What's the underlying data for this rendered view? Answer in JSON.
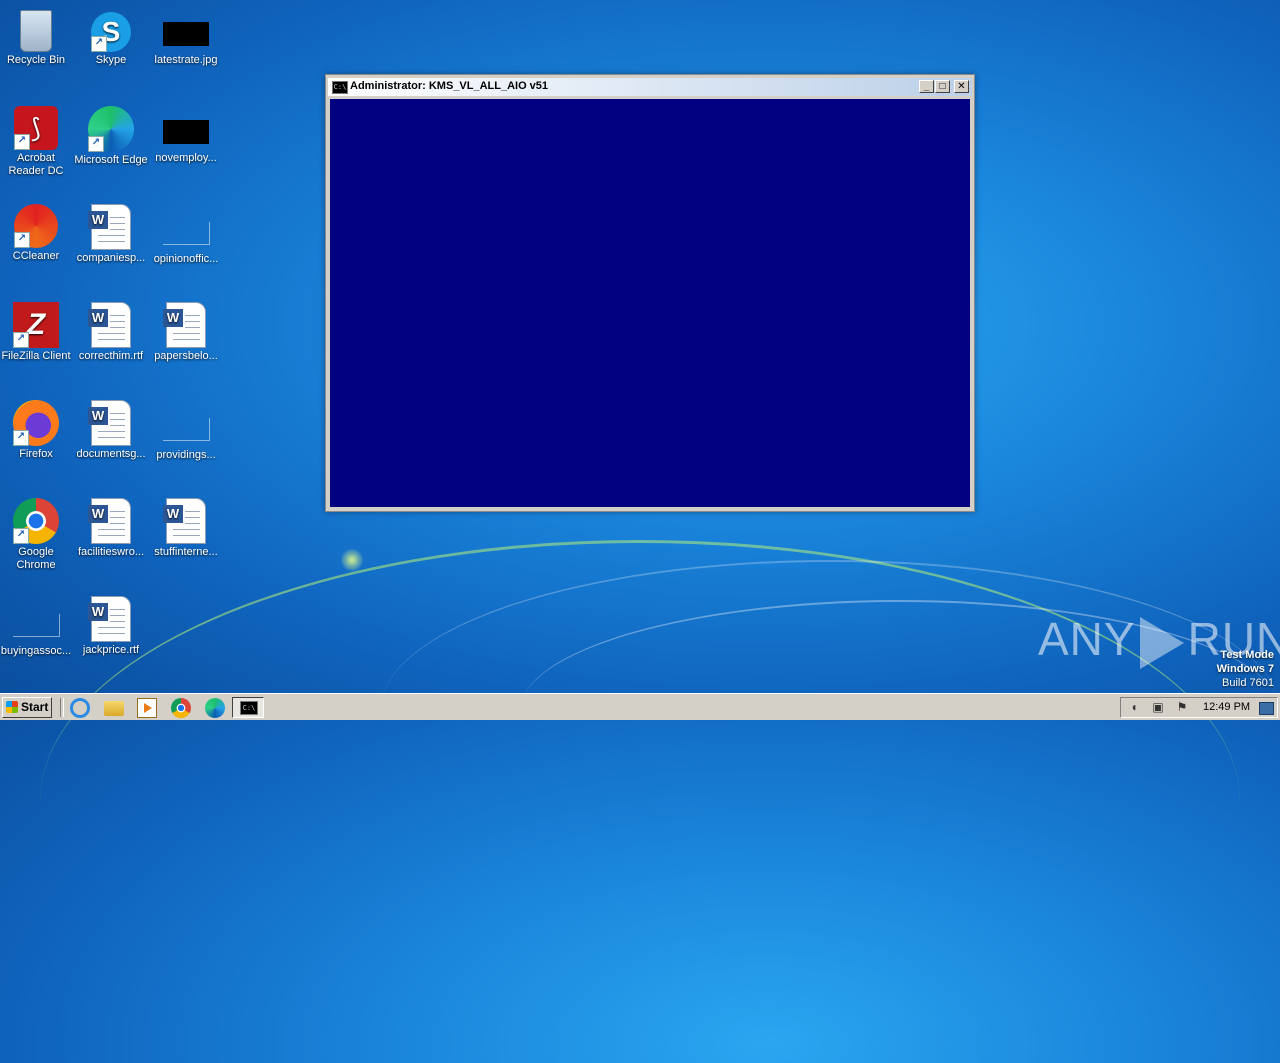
{
  "desktop": {
    "icons": [
      {
        "label": "Recycle Bin"
      },
      {
        "label": "Skype"
      },
      {
        "label": "latestrate.jpg"
      },
      {
        "label": "Acrobat Reader DC"
      },
      {
        "label": "Microsoft Edge"
      },
      {
        "label": "novemploy..."
      },
      {
        "label": "CCleaner"
      },
      {
        "label": "companiesp..."
      },
      {
        "label": "opinionoffic..."
      },
      {
        "label": "FileZilla Client"
      },
      {
        "label": "correcthim.rtf"
      },
      {
        "label": "papersbelo..."
      },
      {
        "label": "Firefox"
      },
      {
        "label": "documentsg..."
      },
      {
        "label": "providings..."
      },
      {
        "label": "Google Chrome"
      },
      {
        "label": "facilitieswro..."
      },
      {
        "label": "stuffinterne..."
      },
      {
        "label": "buyingassoc..."
      },
      {
        "label": "jackprice.rtf"
      }
    ]
  },
  "window": {
    "title": "Administrator:  KMS_VL_ALL_AIO v51",
    "icon_glyph": "C:\\",
    "minimize_glyph": "_",
    "maximize_glyph": "□",
    "close_glyph": "✕",
    "console_bg": "#000080"
  },
  "watermark": {
    "brand_left": "ANY",
    "brand_right": "RUN",
    "line1": "Test Mode",
    "line2": "Windows 7",
    "line3": "Build 7601"
  },
  "taskbar": {
    "start_label": "Start",
    "cmd_glyph": "C:\\",
    "clock": "12:49 PM",
    "tray_icons": [
      "speaker-icon",
      "network-icon",
      "flag-icon"
    ]
  }
}
